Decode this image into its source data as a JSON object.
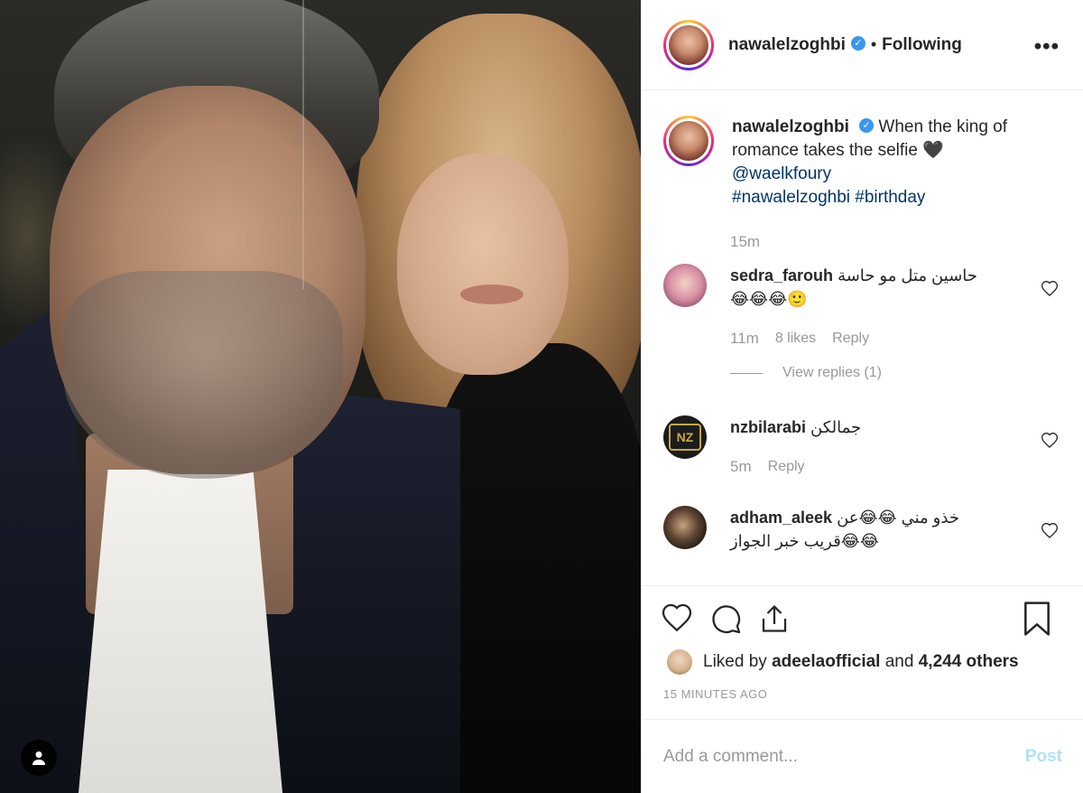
{
  "post": {
    "username": "nawalelzoghbi",
    "follow_status": "Following",
    "more_label": "•••",
    "caption_text": "When the king of romance takes the selfie 🖤",
    "caption_mention": "@waelkfoury",
    "caption_tags": "#nawalelzoghbi #birthday",
    "caption_time": "15m"
  },
  "comments": [
    {
      "username": "sedra_farouh",
      "text": "حاسين متل مو حاسة",
      "emoji": "😂😂😂🙂",
      "time": "11m",
      "likes": "8 likes",
      "reply_label": "Reply",
      "view_replies": "View replies (1)"
    },
    {
      "username": "nzbilarabi",
      "text": "جمالكن",
      "badge": "NZ",
      "time": "5m",
      "reply_label": "Reply"
    },
    {
      "username": "adham_aleek",
      "text": "خذو مني 😂😂عن",
      "text2": "😂😂قريب خبر الجواز"
    }
  ],
  "actions": {
    "liked_by_prefix": "Liked by",
    "liked_by_user": "adeelaofficial",
    "liked_by_and": "and",
    "liked_by_count": "4,244 others",
    "timestamp": "15 MINUTES AGO"
  },
  "add_comment": {
    "placeholder": "Add a comment...",
    "post_label": "Post"
  },
  "colors": {
    "link": "#003569",
    "verified": "#3897f0",
    "post_disabled": "#b2dffc"
  }
}
